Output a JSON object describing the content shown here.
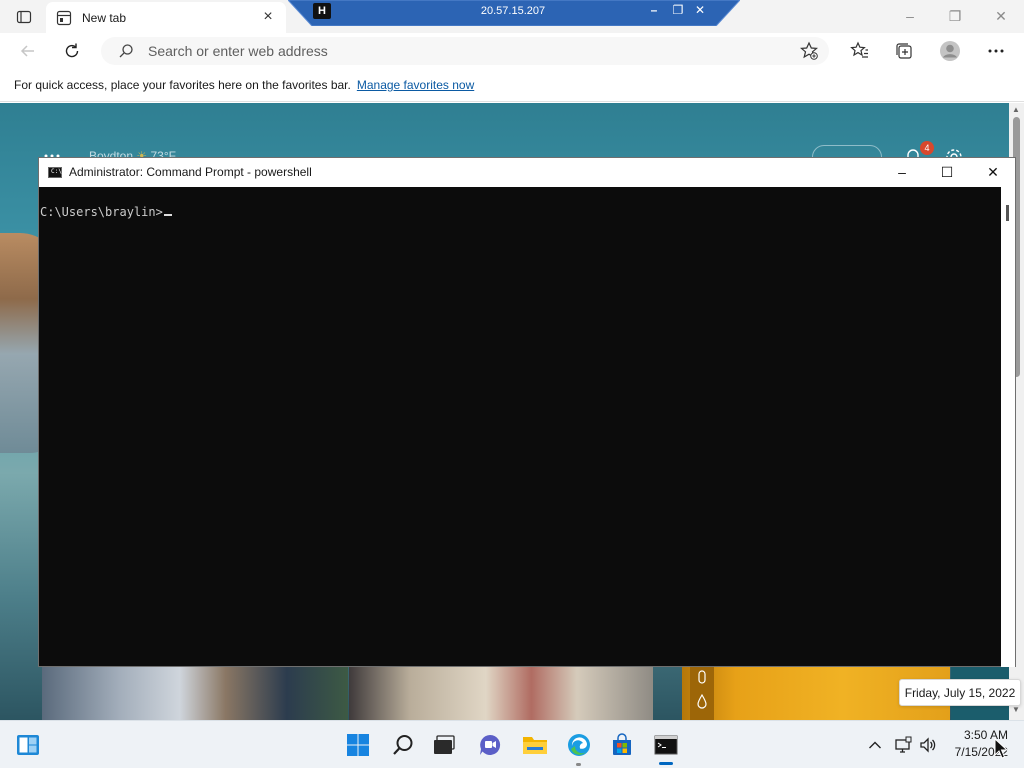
{
  "browser": {
    "tab_title": "New tab",
    "address_placeholder": "Search or enter web address",
    "favorites_bar_text": "For quick access, place your favorites here on the favorites bar.",
    "favorites_bar_link": "Manage favorites now"
  },
  "remote_bar": {
    "host": "20.57.15.207"
  },
  "new_tab_page": {
    "weather_location": "Boydton",
    "weather_temp": "73°F",
    "notification_count": "4"
  },
  "console": {
    "title": "Administrator: Command Prompt - powershell",
    "prompt": "C:\\Users\\braylin>"
  },
  "tooltip": {
    "date": "Friday, July 15, 2022"
  },
  "clock": {
    "time": "3:50 AM",
    "date": "7/15/2022"
  },
  "colors": {
    "accent": "#0067c0",
    "remote_bar": "#2c64b4",
    "console_bg": "#0c0c0c",
    "notification_badge": "#d8482d"
  }
}
